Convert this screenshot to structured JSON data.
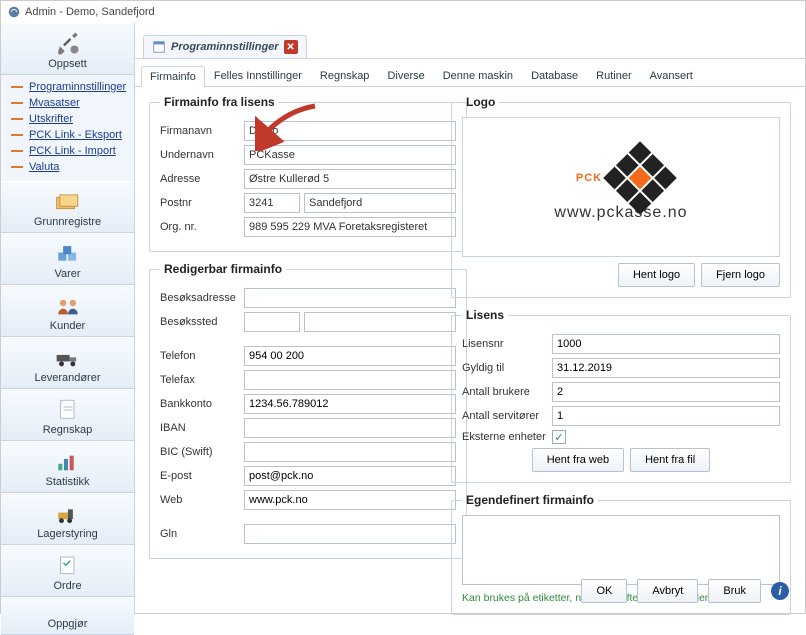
{
  "window": {
    "title": "Admin - Demo, Sandefjord"
  },
  "sidebar": {
    "sections": [
      {
        "label": "Oppsett"
      },
      {
        "label": "Grunnregistre"
      },
      {
        "label": "Varer"
      },
      {
        "label": "Kunder"
      },
      {
        "label": "Leverandører"
      },
      {
        "label": "Regnskap"
      },
      {
        "label": "Statistikk"
      },
      {
        "label": "Lagerstyring"
      },
      {
        "label": "Ordre"
      },
      {
        "label": "Oppgjør"
      }
    ],
    "links": [
      "Programinnstillinger",
      "Mvasatser",
      "Utskrifter",
      "PCK Link - Eksport",
      "PCK Link - Import",
      "Valuta"
    ]
  },
  "docTab": {
    "title": "Programinnstillinger"
  },
  "tabs": [
    "Firmainfo",
    "Felles Innstillinger",
    "Regnskap",
    "Diverse",
    "Denne maskin",
    "Database",
    "Rutiner",
    "Avansert"
  ],
  "firmainfoLegend": "Firmainfo fra lisens",
  "labels": {
    "firmanavn": "Firmanavn",
    "undernavn": "Undernavn",
    "adresse": "Adresse",
    "postnr": "Postnr",
    "orgnr": "Org. nr."
  },
  "firmainfo": {
    "firmanavn": "Demo",
    "undernavn": "PCKasse",
    "adresse": "Østre Kullerød 5",
    "postnr": "3241",
    "poststed": "Sandefjord",
    "orgnr": "989 595 229 MVA Foretaksregisteret"
  },
  "editableLegend": "Redigerbar firmainfo",
  "editableLabels": {
    "besoksadresse": "Besøksadresse",
    "besokssted": "Besøkssted",
    "telefon": "Telefon",
    "telefax": "Telefax",
    "bankkonto": "Bankkonto",
    "iban": "IBAN",
    "bic": "BIC (Swift)",
    "epost": "E-post",
    "web": "Web",
    "gln": "Gln"
  },
  "editable": {
    "besoksadresse": "",
    "besoks_nr": "",
    "besoks_sted": "",
    "telefon": "954 00 200",
    "telefax": "",
    "bankkonto": "1234.56.789012",
    "iban": "",
    "bic": "",
    "epost": "post@pck.no",
    "web": "www.pck.no",
    "gln": ""
  },
  "logo": {
    "legend": "Logo",
    "text": "PCK",
    "url": "www.pckasse.no",
    "btn_hent": "Hent logo",
    "btn_fjern": "Fjern logo"
  },
  "lisens": {
    "legend": "Lisens",
    "labels": {
      "lisensnr": "Lisensnr",
      "gyldigtil": "Gyldig til",
      "antallbrukere": "Antall brukere",
      "antallservitorer": "Antall servitører",
      "eksterne": "Eksterne enheter"
    },
    "values": {
      "lisensnr": "1000",
      "gyldigtil": "31.12.2019",
      "antallbrukere": "2",
      "antallservitorer": "1",
      "eksterne": true
    },
    "btn_web": "Hent fra web",
    "btn_fil": "Hent fra fil"
  },
  "egendef": {
    "legend": "Egendefinert firmainfo",
    "text": "",
    "hint": "Kan brukes på etiketter, noen utskrifter og wordmaler"
  },
  "footer": {
    "ok": "OK",
    "avbryt": "Avbryt",
    "bruk": "Bruk"
  }
}
